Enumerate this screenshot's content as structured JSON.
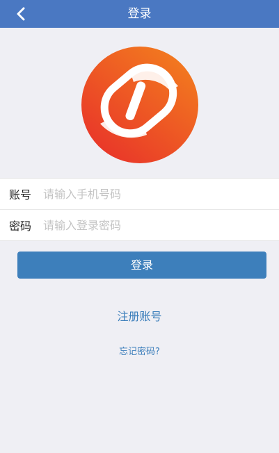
{
  "header": {
    "title": "登录",
    "back_icon": "chevron-left-icon",
    "background_color": "#4a78c2"
  },
  "logo": {
    "icon": "brand-logo",
    "colors": [
      "#f3801e",
      "#e8362a"
    ]
  },
  "form": {
    "account_label": "账号",
    "account_placeholder": "请输入手机号码",
    "account_value": "",
    "password_label": "密码",
    "password_placeholder": "请输入登录密码",
    "password_value": ""
  },
  "actions": {
    "login_label": "登录",
    "login_color": "#3d7fbb",
    "register_label": "注册账号",
    "forgot_label": "忘记密码?"
  }
}
